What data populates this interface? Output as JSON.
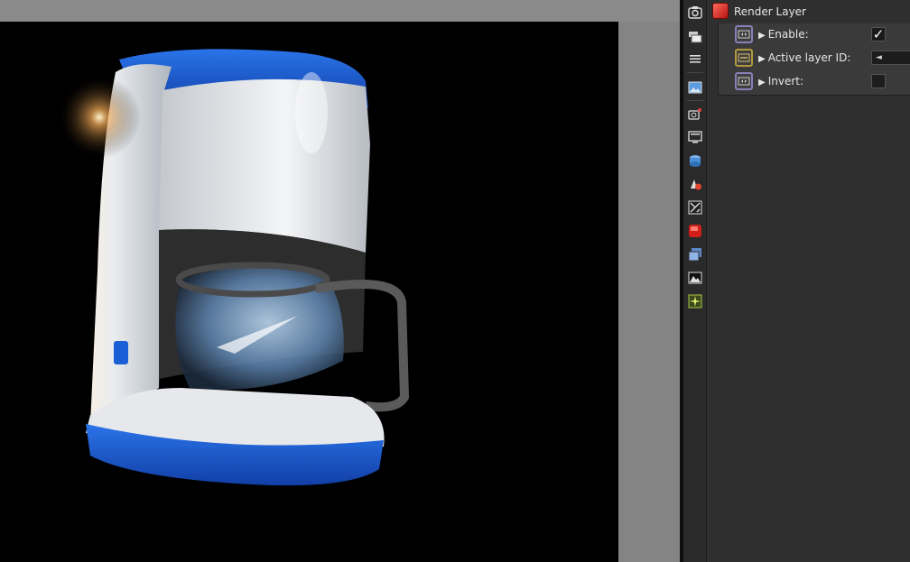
{
  "node_panel": {
    "title": "Render Layer",
    "rows": [
      {
        "label": "Enable:",
        "pin_type": "bool",
        "control": "checkbox",
        "checked": true
      },
      {
        "label": "Active layer ID:",
        "pin_type": "int",
        "control": "number",
        "arrow": "◄"
      },
      {
        "label": "Invert:",
        "pin_type": "bool",
        "control": "checkbox",
        "checked": false
      }
    ],
    "expand_glyph": "▶",
    "check_glyph": "✓"
  },
  "toolbar": {
    "icons": [
      "camera-icon",
      "layers-icon",
      "list-icon",
      "image-icon",
      "film-camera-icon",
      "monitor-icon",
      "environment-icon",
      "material-icon",
      "texture-icon",
      "render-layer-icon",
      "multi-layer-icon",
      "imager-icon",
      "postprocess-icon"
    ]
  },
  "colors": {
    "render_layer_accent": "#d21f1a",
    "bool_pin": "#8a7fb8",
    "int_pin": "#b09a3c",
    "panel_bg": "#2f2f2f",
    "appliance_blue": "#1b5fd6"
  },
  "viewport": {
    "subject": "coffee-maker-render"
  }
}
